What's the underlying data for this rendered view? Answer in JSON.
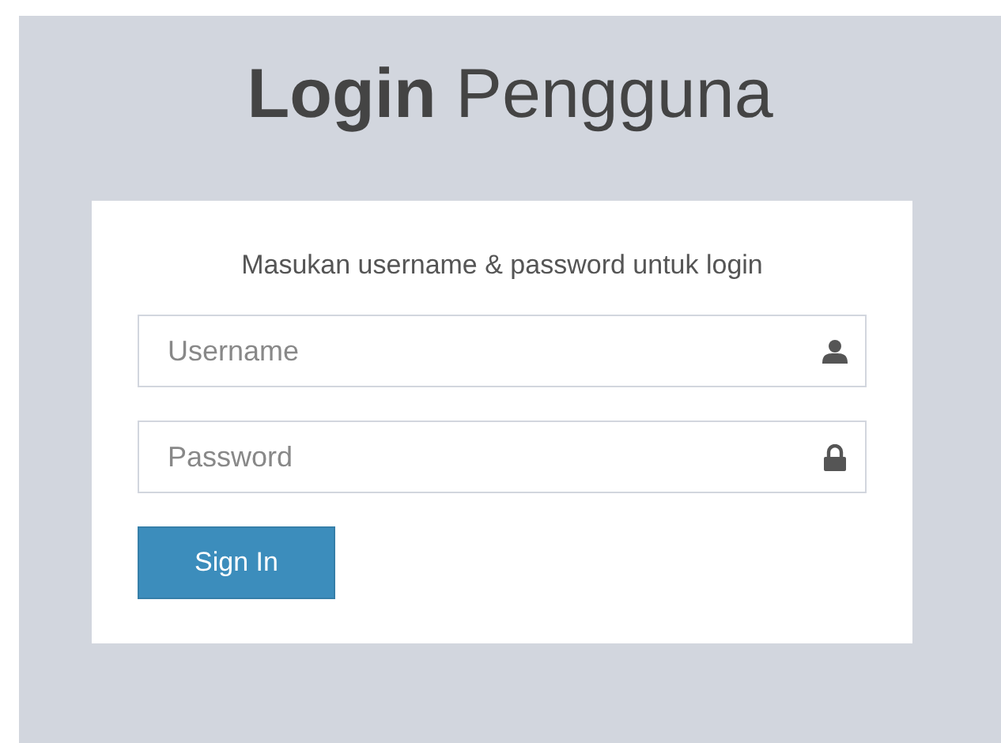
{
  "title": "**Login** Pengguna",
  "card": {
    "message": "Masukan username & password untuk login",
    "fields": [
      {
        "kind": "user",
        "placeholder": "Username"
      },
      {
        "kind": "lock",
        "placeholder": "Password"
      }
    ],
    "button": "Sign In"
  }
}
